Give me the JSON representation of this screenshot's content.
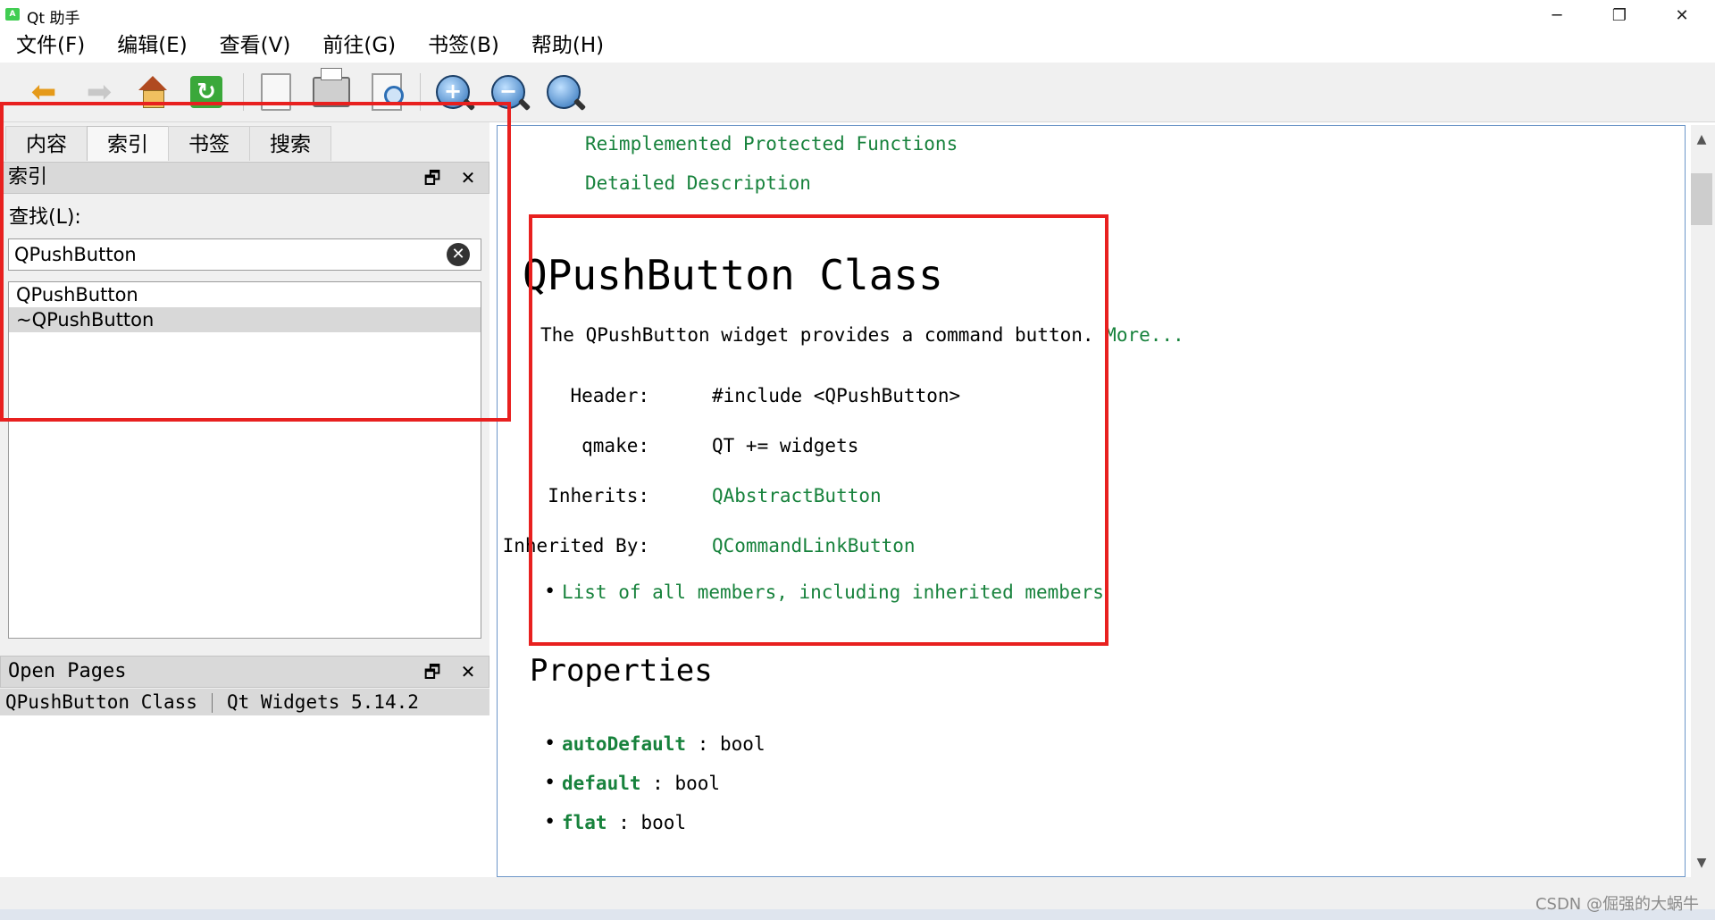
{
  "window": {
    "title": "Qt 助手",
    "app_icon_text": "A",
    "min": "─",
    "max": "❐",
    "close": "✕"
  },
  "menu": [
    "文件(F)",
    "编辑(E)",
    "查看(V)",
    "前往(G)",
    "书签(B)",
    "帮助(H)"
  ],
  "toolbar": {
    "zoom_in": "+",
    "zoom_out": "−",
    "refresh": "↻"
  },
  "left": {
    "tabs": [
      "内容",
      "索引",
      "书签",
      "搜索"
    ],
    "index_dock_title": "索引",
    "find_label": "查找(L):",
    "search_value": "QPushButton",
    "clear_symbol": "✕",
    "results": [
      "QPushButton",
      "~QPushButton"
    ],
    "open_pages_title": "Open Pages",
    "open_page": {
      "title": "QPushButton Class",
      "module": "Qt Widgets 5.14.2"
    },
    "float_symbol": "🗗",
    "close_symbol": "✕"
  },
  "doc": {
    "links_top": [
      "Reimplemented Protected Functions",
      "Detailed Description"
    ],
    "class_title": "QPushButton Class",
    "desc": "The QPushButton widget provides a command button.",
    "more": "More...",
    "info": [
      {
        "key": "Header:",
        "value": "#include <QPushButton>",
        "link": false
      },
      {
        "key": "qmake:",
        "value": "QT += widgets",
        "link": false
      },
      {
        "key": "Inherits:",
        "value": "QAbstractButton",
        "link": true
      },
      {
        "key": "Inherited By:",
        "value": "QCommandLinkButton",
        "link": true
      }
    ],
    "members_link": "List of all members, including inherited members",
    "properties_heading": "Properties",
    "properties": [
      {
        "name": "autoDefault",
        "type": ": bool"
      },
      {
        "name": "default",
        "type": ": bool"
      },
      {
        "name": "flat",
        "type": ": bool"
      }
    ]
  },
  "scroll": {
    "up": "▲",
    "down": "▼"
  },
  "watermark": "CSDN @倔强的大蜗牛",
  "colors": {
    "link": "#17823c",
    "annotation": "#e8201f",
    "content_border": "#6d96c8"
  }
}
